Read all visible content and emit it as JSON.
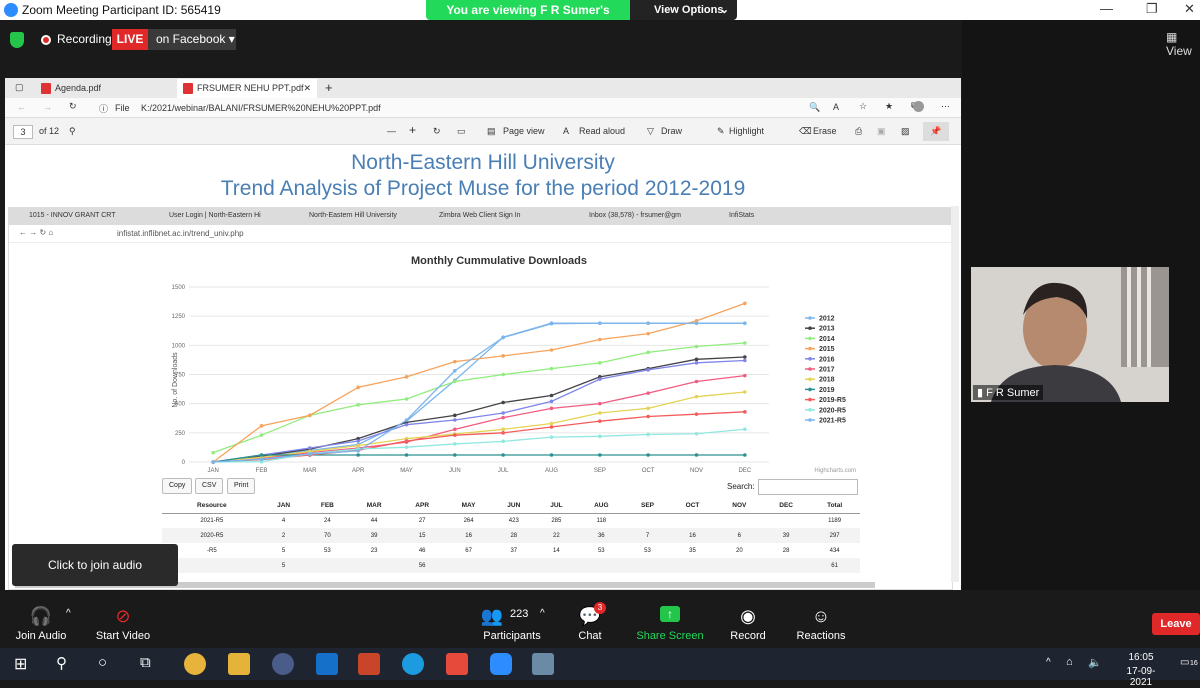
{
  "window": {
    "title": "Zoom Meeting Participant ID: 565419"
  },
  "banner": {
    "viewing": "You are viewing F R Sumer's screen",
    "view_options": "View Options",
    "chevron": "⌄"
  },
  "status": {
    "recording": "Recording",
    "live": "LIVE",
    "facebook": "on Facebook ▾"
  },
  "right": {
    "gallery_label": "View",
    "participant_name": "F R Sumer"
  },
  "edge": {
    "tabs": [
      "Agenda.pdf",
      "FRSUMER NEHU PPT.pdf"
    ],
    "new_tab": "+",
    "file_label": "File",
    "url": "K:/2021/webinar/BALANI/FRSUMER%20NEHU%20PPT.pdf"
  },
  "pdf": {
    "page": "3",
    "of": "of 12",
    "tools": {
      "minus": "—",
      "plus": "+",
      "page_view": "Page view",
      "read_aloud": "Read aloud",
      "draw": "Draw",
      "highlight": "Highlight",
      "erase": "Erase"
    }
  },
  "slide": {
    "title1": "North-Eastern Hill University",
    "title2": "Trend Analysis of Project Muse for the period 2012-2019"
  },
  "inner": {
    "tabs": [
      "1015 - INNOV GRANT CRT",
      "User Login | North-Eastern Hi",
      "North-Eastern Hill University",
      "Zimbra Web Client Sign In",
      "Inbox (38,578) - frsumer@gm",
      "InfiStats"
    ],
    "url": "infistat.inflibnet.ac.in/trend_univ.php",
    "buttons": {
      "copy": "Copy",
      "csv": "CSV",
      "print": "Print"
    },
    "search_label": "Search:",
    "credits": "Highcharts.com"
  },
  "chart_data": {
    "type": "line",
    "title": "Monthly Cummulative Downloads",
    "ylabel": "No. of Downloads",
    "xlabel": "",
    "categories": [
      "JAN",
      "FEB",
      "MAR",
      "APR",
      "MAY",
      "JUN",
      "JUL",
      "AUG",
      "SEP",
      "OCT",
      "NOV",
      "DEC"
    ],
    "ylim": [
      0,
      1500
    ],
    "yticks": [
      0,
      250,
      500,
      750,
      1000,
      1250,
      1500
    ],
    "legend_position": "right",
    "series": [
      {
        "name": "2012",
        "color": "#7cb5ec",
        "values": [
          0,
          50,
          100,
          150,
          350,
          700,
          1070,
          1190,
          1190,
          1190,
          1190,
          1190
        ]
      },
      {
        "name": "2013",
        "color": "#434348",
        "values": [
          0,
          50,
          110,
          200,
          340,
          400,
          510,
          570,
          730,
          800,
          880,
          900
        ]
      },
      {
        "name": "2014",
        "color": "#90ed7d",
        "values": [
          80,
          230,
          400,
          490,
          540,
          690,
          750,
          800,
          850,
          940,
          990,
          1020
        ]
      },
      {
        "name": "2015",
        "color": "#f7a35c",
        "values": [
          0,
          310,
          400,
          640,
          730,
          860,
          910,
          960,
          1050,
          1100,
          1210,
          1360
        ]
      },
      {
        "name": "2016",
        "color": "#8085e9",
        "values": [
          0,
          60,
          120,
          180,
          320,
          360,
          420,
          520,
          710,
          790,
          850,
          870
        ]
      },
      {
        "name": "2017",
        "color": "#f15c80",
        "values": [
          0,
          30,
          80,
          120,
          170,
          280,
          380,
          460,
          500,
          590,
          690,
          740
        ]
      },
      {
        "name": "2018",
        "color": "#e4d354",
        "values": [
          0,
          40,
          90,
          140,
          200,
          240,
          280,
          330,
          420,
          460,
          560,
          600
        ]
      },
      {
        "name": "2019",
        "color": "#2b908f",
        "values": [
          0,
          60,
          60,
          60,
          60,
          60,
          60,
          60,
          60,
          60,
          60,
          60
        ]
      },
      {
        "name": "2019-R5",
        "color": "#f45b5b",
        "values": [
          0,
          20,
          60,
          100,
          180,
          230,
          250,
          300,
          350,
          390,
          410,
          430
        ]
      },
      {
        "name": "2020-R5",
        "color": "#91e8e1",
        "values": [
          0,
          2,
          72,
          111,
          127,
          155,
          177,
          213,
          220,
          236,
          242,
          281
        ]
      },
      {
        "name": "2021-R5",
        "color": "#7cb5ec",
        "values": [
          0,
          24,
          68,
          95,
          359,
          782,
          1067,
          1185,
          1189,
          1189,
          1189,
          1189
        ]
      }
    ]
  },
  "table": {
    "headers": [
      "Resource",
      "JAN",
      "FEB",
      "MAR",
      "APR",
      "MAY",
      "JUN",
      "JUL",
      "AUG",
      "SEP",
      "OCT",
      "NOV",
      "DEC",
      "Total"
    ],
    "rows": [
      [
        "2021-R5",
        "4",
        "24",
        "44",
        "27",
        "264",
        "423",
        "285",
        "118",
        "",
        "",
        "",
        "",
        "1189"
      ],
      [
        "2020-R5",
        "2",
        "70",
        "39",
        "15",
        "16",
        "28",
        "22",
        "36",
        "7",
        "16",
        "6",
        "39",
        "297"
      ],
      [
        "-R5",
        "5",
        "53",
        "23",
        "46",
        "67",
        "37",
        "14",
        "53",
        "53",
        "35",
        "20",
        "28",
        "434"
      ],
      [
        "",
        "5",
        "",
        "",
        "56",
        "",
        "",
        "",
        "",
        "",
        "",
        "",
        "",
        "61"
      ]
    ]
  },
  "toolbar": {
    "join_audio": "Join Audio",
    "start_video": "Start Video",
    "participants_count": "223",
    "participants": "Participants",
    "chat": "Chat",
    "chat_badge": "3",
    "share_screen": "Share Screen",
    "record": "Record",
    "reactions": "Reactions",
    "leave": "Leave",
    "join_tip": "Click to join audio"
  },
  "taskbar": {
    "time": "16:05",
    "date": "17-09-2021",
    "badge": "16"
  }
}
